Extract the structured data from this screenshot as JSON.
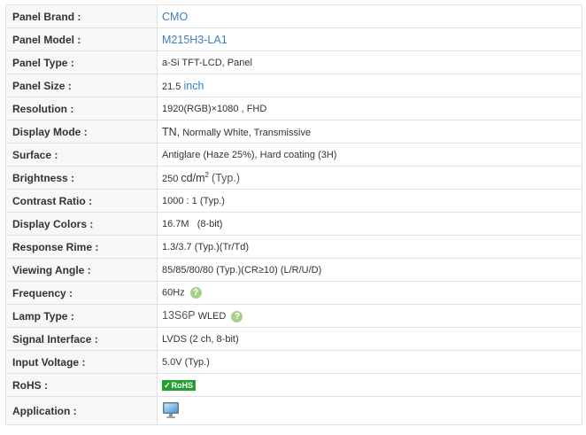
{
  "rows": [
    {
      "label": "Panel Brand :",
      "value": "CMO"
    },
    {
      "label": "Panel Model :",
      "value": "M215H3-LA1"
    },
    {
      "label": "Panel Type :",
      "value": "a-Si TFT-LCD, Panel"
    },
    {
      "label": "Panel Size :",
      "value": "21.5",
      "unit": "inch"
    },
    {
      "label": "Resolution :",
      "value": "1920(RGB)×1080 , FHD"
    },
    {
      "label": "Display Mode :",
      "value_main": "TN,",
      "value_rest": "Normally White, Transmissive"
    },
    {
      "label": "Surface :",
      "value": "Antiglare (Haze 25%), Hard coating (3H)"
    },
    {
      "label": "Brightness :",
      "value": "250",
      "unit": "cd/m",
      "unit_sup": "2",
      "note": "(Typ.)"
    },
    {
      "label": "Contrast Ratio :",
      "value": "1000 : 1 (Typ.)"
    },
    {
      "label": "Display Colors :",
      "value": "16.7M   (8-bit)"
    },
    {
      "label": "Response Rime :",
      "value": "1.3/3.7 (Typ.)(Tr/Td)"
    },
    {
      "label": "Viewing Angle :",
      "value": "85/85/80/80 (Typ.)(CR≥10) (L/R/U/D)"
    },
    {
      "label": "Frequency :",
      "value": "60Hz",
      "help": "?"
    },
    {
      "label": "Lamp Type :",
      "value_main": "13S6P",
      "value_rest": "WLED",
      "help": "?"
    },
    {
      "label": "Signal Interface :",
      "value": "LVDS (2 ch, 8-bit)"
    },
    {
      "label": "Input Voltage :",
      "value": "5.0V (Typ.)"
    },
    {
      "label": "RoHS :",
      "badge_check": "✓",
      "badge": "RoHS"
    },
    {
      "label": "Application :",
      "icon": "monitor-icon"
    }
  ]
}
